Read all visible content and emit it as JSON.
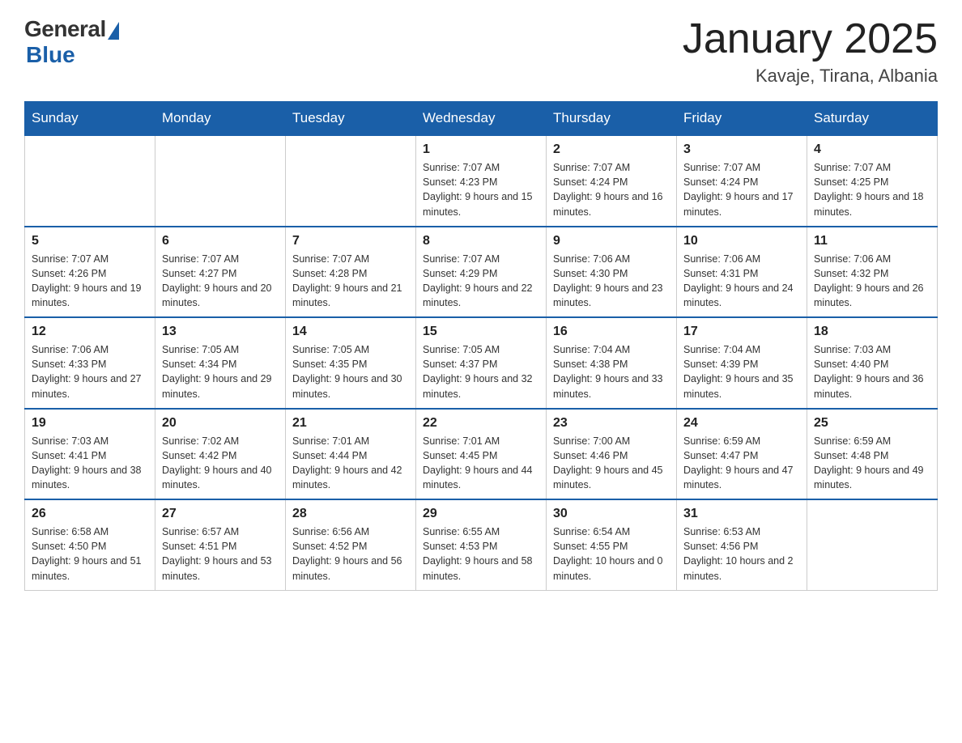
{
  "logo": {
    "general": "General",
    "blue": "Blue"
  },
  "title": "January 2025",
  "subtitle": "Kavaje, Tirana, Albania",
  "weekdays": [
    "Sunday",
    "Monday",
    "Tuesday",
    "Wednesday",
    "Thursday",
    "Friday",
    "Saturday"
  ],
  "weeks": [
    [
      {
        "day": "",
        "info": ""
      },
      {
        "day": "",
        "info": ""
      },
      {
        "day": "",
        "info": ""
      },
      {
        "day": "1",
        "info": "Sunrise: 7:07 AM\nSunset: 4:23 PM\nDaylight: 9 hours and 15 minutes."
      },
      {
        "day": "2",
        "info": "Sunrise: 7:07 AM\nSunset: 4:24 PM\nDaylight: 9 hours and 16 minutes."
      },
      {
        "day": "3",
        "info": "Sunrise: 7:07 AM\nSunset: 4:24 PM\nDaylight: 9 hours and 17 minutes."
      },
      {
        "day": "4",
        "info": "Sunrise: 7:07 AM\nSunset: 4:25 PM\nDaylight: 9 hours and 18 minutes."
      }
    ],
    [
      {
        "day": "5",
        "info": "Sunrise: 7:07 AM\nSunset: 4:26 PM\nDaylight: 9 hours and 19 minutes."
      },
      {
        "day": "6",
        "info": "Sunrise: 7:07 AM\nSunset: 4:27 PM\nDaylight: 9 hours and 20 minutes."
      },
      {
        "day": "7",
        "info": "Sunrise: 7:07 AM\nSunset: 4:28 PM\nDaylight: 9 hours and 21 minutes."
      },
      {
        "day": "8",
        "info": "Sunrise: 7:07 AM\nSunset: 4:29 PM\nDaylight: 9 hours and 22 minutes."
      },
      {
        "day": "9",
        "info": "Sunrise: 7:06 AM\nSunset: 4:30 PM\nDaylight: 9 hours and 23 minutes."
      },
      {
        "day": "10",
        "info": "Sunrise: 7:06 AM\nSunset: 4:31 PM\nDaylight: 9 hours and 24 minutes."
      },
      {
        "day": "11",
        "info": "Sunrise: 7:06 AM\nSunset: 4:32 PM\nDaylight: 9 hours and 26 minutes."
      }
    ],
    [
      {
        "day": "12",
        "info": "Sunrise: 7:06 AM\nSunset: 4:33 PM\nDaylight: 9 hours and 27 minutes."
      },
      {
        "day": "13",
        "info": "Sunrise: 7:05 AM\nSunset: 4:34 PM\nDaylight: 9 hours and 29 minutes."
      },
      {
        "day": "14",
        "info": "Sunrise: 7:05 AM\nSunset: 4:35 PM\nDaylight: 9 hours and 30 minutes."
      },
      {
        "day": "15",
        "info": "Sunrise: 7:05 AM\nSunset: 4:37 PM\nDaylight: 9 hours and 32 minutes."
      },
      {
        "day": "16",
        "info": "Sunrise: 7:04 AM\nSunset: 4:38 PM\nDaylight: 9 hours and 33 minutes."
      },
      {
        "day": "17",
        "info": "Sunrise: 7:04 AM\nSunset: 4:39 PM\nDaylight: 9 hours and 35 minutes."
      },
      {
        "day": "18",
        "info": "Sunrise: 7:03 AM\nSunset: 4:40 PM\nDaylight: 9 hours and 36 minutes."
      }
    ],
    [
      {
        "day": "19",
        "info": "Sunrise: 7:03 AM\nSunset: 4:41 PM\nDaylight: 9 hours and 38 minutes."
      },
      {
        "day": "20",
        "info": "Sunrise: 7:02 AM\nSunset: 4:42 PM\nDaylight: 9 hours and 40 minutes."
      },
      {
        "day": "21",
        "info": "Sunrise: 7:01 AM\nSunset: 4:44 PM\nDaylight: 9 hours and 42 minutes."
      },
      {
        "day": "22",
        "info": "Sunrise: 7:01 AM\nSunset: 4:45 PM\nDaylight: 9 hours and 44 minutes."
      },
      {
        "day": "23",
        "info": "Sunrise: 7:00 AM\nSunset: 4:46 PM\nDaylight: 9 hours and 45 minutes."
      },
      {
        "day": "24",
        "info": "Sunrise: 6:59 AM\nSunset: 4:47 PM\nDaylight: 9 hours and 47 minutes."
      },
      {
        "day": "25",
        "info": "Sunrise: 6:59 AM\nSunset: 4:48 PM\nDaylight: 9 hours and 49 minutes."
      }
    ],
    [
      {
        "day": "26",
        "info": "Sunrise: 6:58 AM\nSunset: 4:50 PM\nDaylight: 9 hours and 51 minutes."
      },
      {
        "day": "27",
        "info": "Sunrise: 6:57 AM\nSunset: 4:51 PM\nDaylight: 9 hours and 53 minutes."
      },
      {
        "day": "28",
        "info": "Sunrise: 6:56 AM\nSunset: 4:52 PM\nDaylight: 9 hours and 56 minutes."
      },
      {
        "day": "29",
        "info": "Sunrise: 6:55 AM\nSunset: 4:53 PM\nDaylight: 9 hours and 58 minutes."
      },
      {
        "day": "30",
        "info": "Sunrise: 6:54 AM\nSunset: 4:55 PM\nDaylight: 10 hours and 0 minutes."
      },
      {
        "day": "31",
        "info": "Sunrise: 6:53 AM\nSunset: 4:56 PM\nDaylight: 10 hours and 2 minutes."
      },
      {
        "day": "",
        "info": ""
      }
    ]
  ]
}
